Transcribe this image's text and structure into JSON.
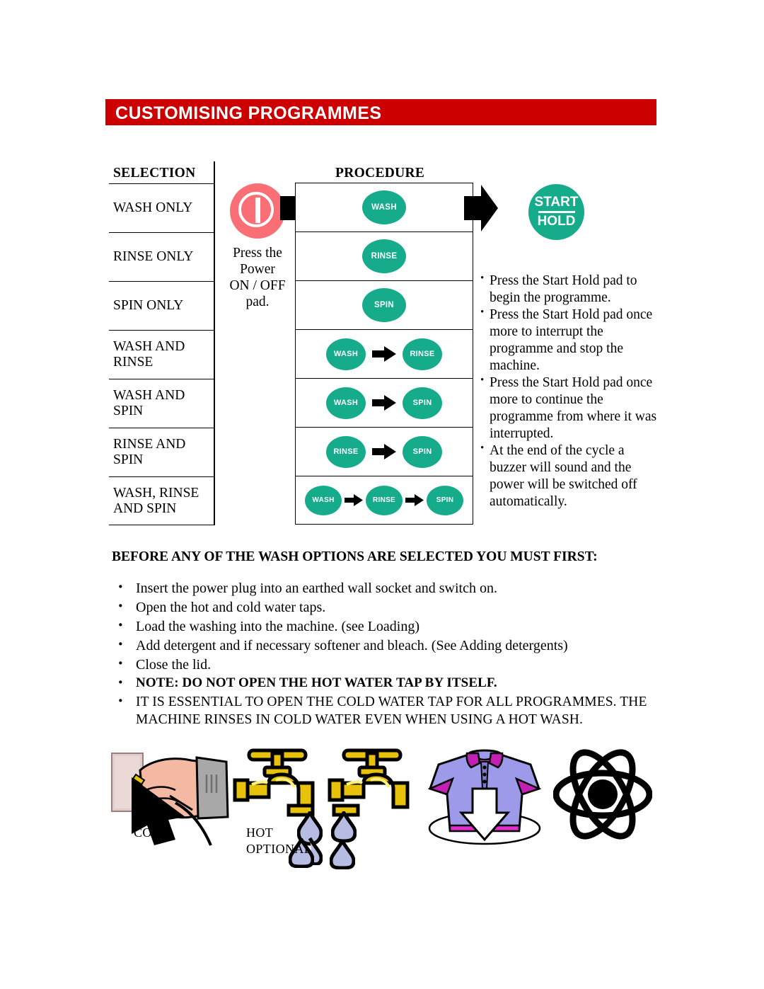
{
  "header": {
    "title": "CUSTOMISING PROGRAMMES",
    "bar_color": "#CC0000"
  },
  "table": {
    "col_headers": {
      "selection": "SELECTION",
      "procedure": "PROCEDURE"
    },
    "rows": [
      {
        "selection_line1": "WASH ONLY",
        "selection_line2": "",
        "steps": [
          "WASH"
        ]
      },
      {
        "selection_line1": "RINSE ONLY",
        "selection_line2": "",
        "steps": [
          "RINSE"
        ]
      },
      {
        "selection_line1": "SPIN ONLY",
        "selection_line2": "",
        "steps": [
          "SPIN"
        ]
      },
      {
        "selection_line1": "WASH AND",
        "selection_line2": "RINSE",
        "steps": [
          "WASH",
          "RINSE"
        ]
      },
      {
        "selection_line1": "WASH AND",
        "selection_line2": "SPIN",
        "steps": [
          "WASH",
          "SPIN"
        ]
      },
      {
        "selection_line1": "RINSE AND",
        "selection_line2": "SPIN",
        "steps": [
          "RINSE",
          "SPIN"
        ]
      },
      {
        "selection_line1": "WASH, RINSE",
        "selection_line2": "AND SPIN",
        "steps": [
          "WASH",
          "RINSE",
          "SPIN"
        ]
      }
    ],
    "badge_color": "#16AB8B"
  },
  "power": {
    "icon": "power-on-off-icon",
    "color": "#FA6E76",
    "caption_line1": "Press the",
    "caption_line2": "Power",
    "caption_line3": "ON / OFF",
    "caption_line4": "pad."
  },
  "start_hold": {
    "line1": "START",
    "line2": "HOLD",
    "color": "#16AB8B"
  },
  "start_hold_notes": [
    "Press the Start Hold pad to begin the programme.",
    "Press the Start  Hold pad once more to interrupt the programme and stop the machine.",
    "Press the Start Hold pad once more to continue the programme from where it was interrupted.",
    "At the end of the cycle a buzzer will sound and the power will be switched off automatically."
  ],
  "before_section": {
    "heading": "BEFORE ANY OF THE WASH OPTIONS ARE SELECTED YOU MUST FIRST:",
    "items": [
      {
        "text": "Insert the power plug into an earthed wall socket and switch on.",
        "style": "normal"
      },
      {
        "text": "Open the hot and cold water taps.",
        "style": "normal"
      },
      {
        "text": "Load the washing into the machine. (see Loading)",
        "style": "normal"
      },
      {
        "text": "Add detergent and if necessary softener and bleach. (See Adding detergents)",
        "style": "normal"
      },
      {
        "text": "Close the lid.",
        "style": "normal"
      },
      {
        "text": "NOTE: DO NOT OPEN THE HOT WATER TAP BY ITSELF.",
        "style": "bold"
      },
      {
        "text": "IT IS ESSENTIAL TO OPEN THE COLD WATER TAP FOR ALL PROGRAMMES. THE MACHINE RINSES IN COLD WATER EVEN WHEN USING A HOT WASH.",
        "style": "caps"
      }
    ]
  },
  "illustrations": {
    "plug_icon": "hand-plug-into-socket-icon",
    "cold_tap_icon": "water-tap-icon",
    "hot_tap_icon": "water-tap-icon",
    "shirt_icon": "load-laundry-shirt-icon",
    "atom_icon": "detergent-atom-icon",
    "label_cold": "COLD",
    "label_hot": "HOT",
    "label_optional": "OPTIONAL",
    "tap_color": "#E8C20A",
    "droplet_color": "#B6BCE2",
    "shirt_color": "#9E9AEA"
  }
}
